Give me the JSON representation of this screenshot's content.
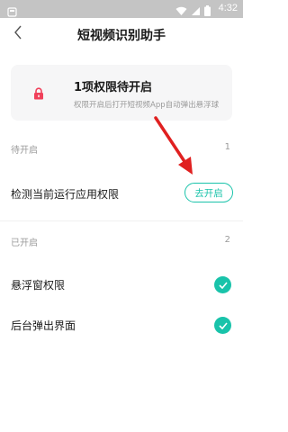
{
  "status_bar": {
    "time": "4:32"
  },
  "header": {
    "title": "短视频识别助手"
  },
  "summary": {
    "title": "1项权限待开启",
    "description": "权限开启后打开短视频App自动弹出悬浮球"
  },
  "pending": {
    "label": "待开启",
    "count": "1",
    "items": [
      {
        "label": "检测当前运行应用权限",
        "action": "去开启"
      }
    ]
  },
  "enabled": {
    "label": "已开启",
    "count": "2",
    "items": [
      {
        "label": "悬浮窗权限"
      },
      {
        "label": "后台弹出界面"
      }
    ]
  },
  "colors": {
    "accent": "#19c3aa",
    "lock": "#f0405a",
    "arrow": "#e02020"
  }
}
